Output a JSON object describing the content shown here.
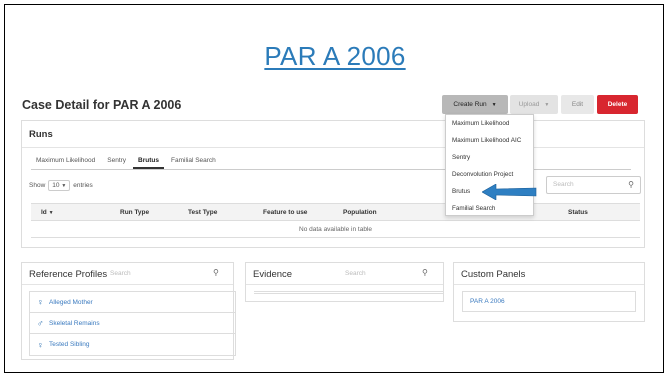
{
  "slide_title": "PAR A 2006",
  "case_title": "Case Detail for PAR A 2006",
  "actions": {
    "create_run": "Create Run",
    "upload": "Upload",
    "edit": "Edit",
    "delete": "Delete"
  },
  "create_run_menu": [
    "Maximum Likelihood",
    "Maximum Likelihood AIC",
    "Sentry",
    "Deconvolution Project",
    "Brutus",
    "Familial Search"
  ],
  "runs": {
    "title": "Runs",
    "tabs": [
      "Maximum Likelihood",
      "Sentry",
      "Brutus",
      "Familial Search"
    ],
    "active_tab": "Brutus",
    "show_label": "Show",
    "entries_value": "10",
    "entries_label": "entries",
    "search_placeholder": "Search",
    "columns": [
      "Id",
      "Run Type",
      "Test Type",
      "Feature to use",
      "Population",
      "Status"
    ],
    "empty_message": "No data available in table"
  },
  "reference_profiles": {
    "title": "Reference Profiles",
    "search_placeholder": "Search",
    "items": [
      {
        "label": "Alleged Mother",
        "icon": "female-icon"
      },
      {
        "label": "Skeletal Remains",
        "icon": "male-icon"
      },
      {
        "label": "Tested Sibling",
        "icon": "female-icon"
      }
    ]
  },
  "evidence": {
    "title": "Evidence",
    "search_placeholder": "Search"
  },
  "custom_panels": {
    "title": "Custom Panels",
    "items": [
      "PAR A 2006"
    ]
  },
  "colors": {
    "link": "#2b7bb9",
    "delete": "#d8262f",
    "annotation_arrow": "#2e7fc2"
  }
}
